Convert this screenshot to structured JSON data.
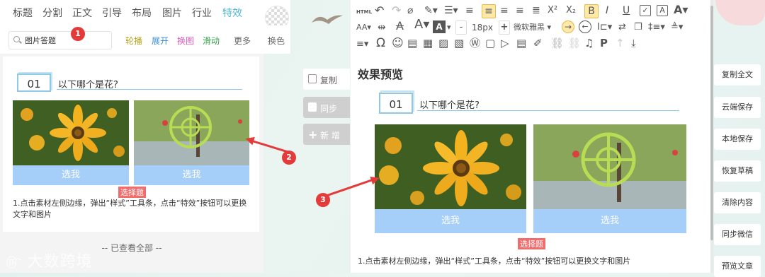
{
  "left": {
    "category_tabs": [
      "标题",
      "分割",
      "正文",
      "引导",
      "布局",
      "图片",
      "行业",
      "特效"
    ],
    "search": {
      "value": "图片答题",
      "badge": "1"
    },
    "filters": [
      {
        "label": "轮播",
        "color": "#b5a522"
      },
      {
        "label": "展开",
        "color": "#3a8fd6"
      },
      {
        "label": "换图",
        "color": "#e05ab8"
      },
      {
        "label": "滑动",
        "color": "#35a04a"
      },
      {
        "label": "更多",
        "color": "#666666"
      }
    ],
    "swatch_label": "换色",
    "card": {
      "number": "01",
      "question": "以下哪个是花?",
      "options": [
        "选我",
        "选我"
      ],
      "selected_tag": "选择题",
      "description": "1.点击素材左侧边缘，弹出“样式”工具条，点击“特效”按钮可以更换文字和图片"
    },
    "more_link": "-- 已查看全部 --",
    "watermark": "大数跨境",
    "arrow_badge": "2"
  },
  "middle_buttons": [
    "复制",
    "同步",
    "新 增"
  ],
  "toolbar": {
    "font_size": "18px",
    "font_family": "微软雅黑",
    "minus": "-",
    "plus": "+",
    "html_label": "HTML",
    "superscript": "X²",
    "subscript": "X₂",
    "bold": "B",
    "italic": "I",
    "underline": "U",
    "text_A": "A",
    "omega": "Ω",
    "paragraph": "P"
  },
  "editor": {
    "preview_title": "效果预览",
    "number": "01",
    "question": "以下哪个是花?",
    "options": [
      "选我",
      "选我"
    ],
    "selected_tag": "选择题",
    "description": "1.点击素材左侧边缘，弹出“样式”工具条，点击“特效”按钮可以更换文字和图片",
    "arrow_badge": "3"
  },
  "right_buttons": [
    "复制全文",
    "云端保存",
    "本地保存",
    "恢复草稿",
    "清除内容",
    "同步微信",
    "预览文章"
  ],
  "colors": {
    "accent": "#4fb8d8",
    "option_bar": "#a5cff8",
    "tag_red": "#f26c6c",
    "badge_red": "#e53a3a"
  },
  "icons": [
    "search-icon",
    "undo-icon",
    "redo-icon",
    "clear-format-icon",
    "format-painter-icon",
    "align-left-icon",
    "align-center-icon",
    "align-right-icon",
    "justify-icon",
    "emoji-icon",
    "image-icon",
    "video-icon",
    "music-icon",
    "link-icon",
    "unlink-icon",
    "upload-icon",
    "download-icon"
  ]
}
